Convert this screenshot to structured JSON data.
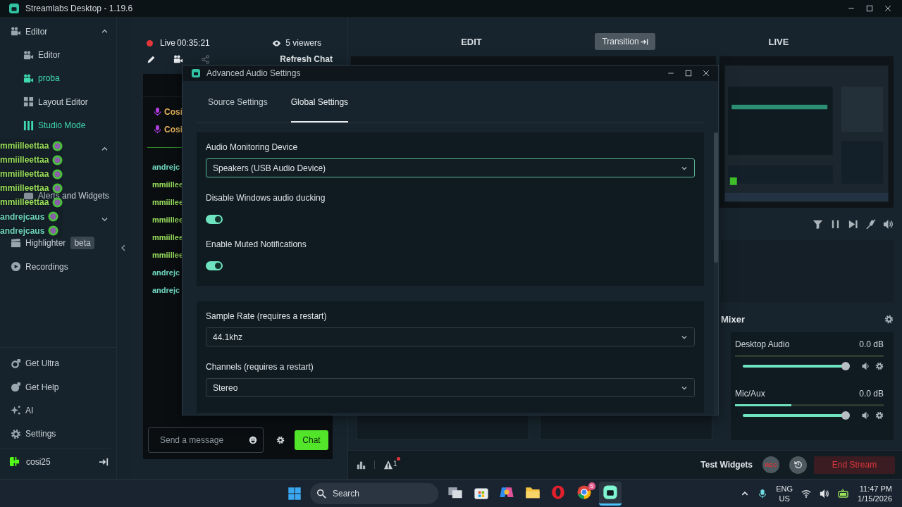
{
  "window": {
    "title": "Streamlabs Desktop - 1.19.6"
  },
  "sidebar": {
    "items": [
      {
        "label": "Editor",
        "expanded": true,
        "children": [
          {
            "label": "Editor",
            "active": false
          },
          {
            "label": "proba",
            "active": true
          },
          {
            "label": "Layout Editor",
            "active": false
          },
          {
            "label": "Studio Mode",
            "active": true
          }
        ]
      },
      {
        "expanded": true,
        "children": [
          {
            "label": "Alerts and Widgets",
            "active": false
          }
        ]
      },
      {
        "expanded": false
      },
      {
        "label": "Highlighter",
        "badge": "beta"
      },
      {
        "label": "Recordings"
      }
    ],
    "bottom_items": [
      "Get Ultra",
      "Get Help",
      "AI",
      "Settings"
    ],
    "user": "cosi25"
  },
  "overlay_chat": [
    {
      "name": "mmiilleettaa",
      "color": "#9be15d"
    },
    {
      "name": "mmiilleettaa",
      "color": "#9be15d"
    },
    {
      "name": "mmiilleettaa",
      "color": "#9be15d"
    },
    {
      "name": "mmiilleettaa",
      "color": "#9be15d"
    },
    {
      "name": "mmiilleettaa",
      "color": "#9be15d"
    },
    {
      "name": "andrejcaus",
      "color": "#6fd8c0"
    },
    {
      "name": "andrejcaus",
      "color": "#6fd8c0"
    }
  ],
  "chat": {
    "status": "Live",
    "time": "00:35:21",
    "viewers": "5 viewers",
    "refresh": "Refresh Chat",
    "pinned": [
      "Cosi",
      "Cosi"
    ],
    "messages": [
      {
        "name": "andrejc",
        "color": "#6fd8c0"
      },
      {
        "name": "mmiillee",
        "color": "#9be15d"
      },
      {
        "name": "mmiillee",
        "color": "#9be15d"
      },
      {
        "name": "mmiillee",
        "color": "#9be15d"
      },
      {
        "name": "mmiillee",
        "color": "#9be15d"
      },
      {
        "name": "mmiillee",
        "color": "#9be15d"
      },
      {
        "name": "andrejc",
        "color": "#6fd8c0"
      },
      {
        "name": "andrejc",
        "color": "#6fd8c0"
      }
    ],
    "placeholder": "Send a message",
    "send_button": "Chat"
  },
  "studio": {
    "edit_label": "EDIT",
    "transition_button": "Transition",
    "live_label": "LIVE"
  },
  "mixer": {
    "title": "Mixer",
    "channels": [
      {
        "name": "Desktop Audio",
        "reading": "0.0 dB",
        "meter": {
          "level": 0
        },
        "volume": {
          "level": 1
        }
      },
      {
        "name": "Mic/Aux",
        "reading": "0.0 dB",
        "meter": {
          "level": 0.38
        },
        "volume": {
          "level": 1
        }
      }
    ]
  },
  "footer": {
    "alerts": "1",
    "test_widgets": "Test Widgets",
    "rec": "REC",
    "end_stream": "End Stream"
  },
  "dialog": {
    "title": "Advanced Audio Settings",
    "tabs": [
      {
        "label": "Source Settings",
        "selected": false
      },
      {
        "label": "Global Settings",
        "selected": true
      }
    ],
    "sections": [
      {
        "fields": [
          {
            "kind": "select",
            "label": "Audio Monitoring Device",
            "value": "Speakers (USB Audio Device)",
            "focused": true
          },
          {
            "kind": "toggle",
            "label": "Disable Windows audio ducking",
            "on": true
          },
          {
            "kind": "toggle",
            "label": "Enable Muted Notifications",
            "on": true
          }
        ]
      },
      {
        "fields": [
          {
            "kind": "select",
            "label": "Sample Rate (requires a restart)",
            "value": "44.1khz",
            "focused": false
          },
          {
            "kind": "select",
            "label": "Channels (requires a restart)",
            "value": "Stereo",
            "focused": false
          }
        ]
      }
    ]
  },
  "taskbar": {
    "search": "Search",
    "apps": [
      {
        "active": false
      },
      {
        "active": false
      },
      {
        "active": false
      },
      {
        "active": false
      },
      {
        "active": false
      },
      {
        "active": false,
        "badge": "5"
      },
      {
        "active": true
      }
    ],
    "tray": {
      "language": "ENG",
      "region": "US",
      "time": "11:47 PM",
      "date": "1/15/2026"
    }
  }
}
